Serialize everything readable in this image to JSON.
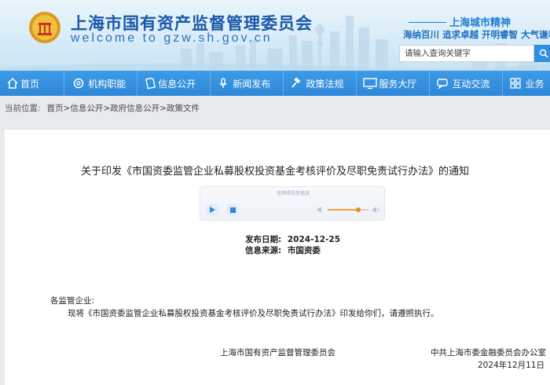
{
  "header": {
    "site_title": "上海市国有资产监督管理委员会",
    "site_url": "welcome to gzw.sh.gov.cn",
    "spirit_title": "上海城市精神",
    "spirit_text": "海纳百川 追求卓越 开明睿智 大气谦和",
    "search": {
      "placeholder": "请输入查询关键字"
    },
    "brand_color": "#1a58a8"
  },
  "nav": {
    "color": "#2e87d8",
    "items": [
      {
        "label": "首页",
        "icon": "home-icon"
      },
      {
        "label": "机构职能",
        "icon": "gear-icon"
      },
      {
        "label": "信息公开",
        "icon": "document-icon"
      },
      {
        "label": "新闻发布",
        "icon": "microphone-icon"
      },
      {
        "label": "政策法规",
        "icon": "gavel-icon"
      },
      {
        "label": "服务大厅",
        "icon": "monitor-icon"
      },
      {
        "label": "互动交流",
        "icon": "chat-icon"
      },
      {
        "label": "业务",
        "icon": "grid-icon"
      }
    ]
  },
  "breadcrumb": {
    "label": "当前位置:",
    "items": [
      "首页",
      ">信息公开",
      ">政府信息公开",
      ">政策文件"
    ]
  },
  "article": {
    "title": "关于印发《市国资委监管企业私募股权投资基金考核评价及尽职免责试行办法》的通知",
    "player": {
      "caption": "无障碍语音播放",
      "volume": 0.75
    },
    "date_label": "发布日期:",
    "date_value": "2024-12-25",
    "source_label": "信息来源:",
    "source_value": "市国资委",
    "salutation": "各监管企业:",
    "body": "现将《市国资委监管企业私募股权投资基金考核评价及尽职免责试行办法》印发给你们，请遵照执行。",
    "signer_1": "上海市国有资产监督管理委员会",
    "signer_2": "中共上海市委金融委员会办公室",
    "sign_date": "2024年12月11日"
  }
}
